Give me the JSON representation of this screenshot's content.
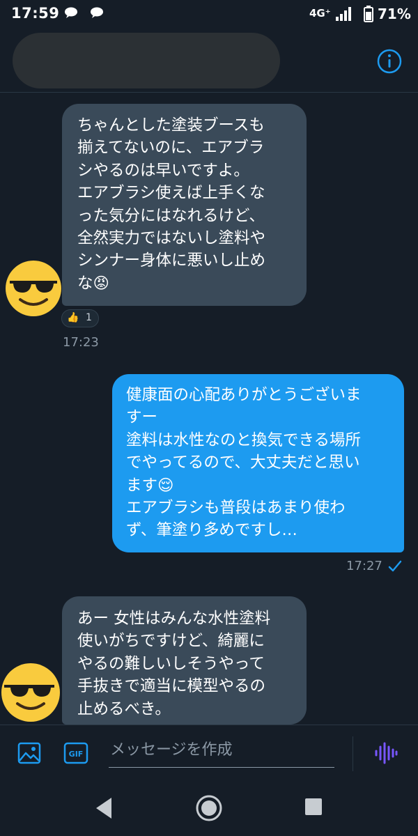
{
  "status_bar": {
    "time": "17:59",
    "network": "4G⁺",
    "battery": "71%"
  },
  "header": {
    "contact_name_redacted": true
  },
  "messages": [
    {
      "direction": "incoming",
      "text": "ちゃんとした塗装ブースも\n揃えてないのに、エアブラ\nシやるのは早いですよ。\nエアブラシ使えば上手くな\nった気分にはなれるけど、\n全然実力ではないし塗料や\nシンナー身体に悪いし止め\nな😡",
      "avatar": "sunglasses-emoji",
      "reaction": {
        "emoji": "👍",
        "count": "1"
      },
      "time": "17:23"
    },
    {
      "direction": "outgoing",
      "text": "健康面の心配ありがとうございま\nすー\n塗料は水性なのと換気できる場所\nでやってるので、大丈夫だと思い\nます😌\nエアブラシも普段はあまり使わ\nず、筆塗り多めですし…",
      "time": "17:27",
      "read": true
    },
    {
      "direction": "incoming",
      "text": "あー 女性はみんな水性塗料\n使いがちですけど、綺麗に\nやるの難しいしそうやって\n手抜きで適当に模型やるの\n止めるべき。",
      "avatar": "sunglasses-emoji"
    }
  ],
  "composer": {
    "placeholder": "メッセージを作成",
    "gif_label": "GIF"
  },
  "colors": {
    "background": "#151d27",
    "incoming_bubble": "#3a4a59",
    "outgoing_bubble": "#1d9bf0",
    "accent": "#1d9bf0",
    "voice_accent": "#7856ff",
    "muted_text": "#8b98a5"
  }
}
